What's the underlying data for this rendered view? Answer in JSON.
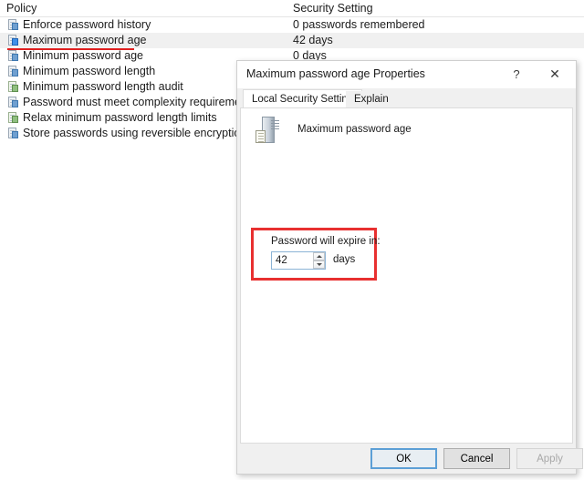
{
  "colors": {
    "annotation_red": "#e83030",
    "selection_gray": "#f0f0f0",
    "focus_blue": "#5c9fd6"
  },
  "policy_list": {
    "columns": [
      "Policy",
      "Security Setting"
    ],
    "rows": [
      {
        "icon": "policy-document-icon",
        "name": "Enforce password history",
        "setting": "0 passwords remembered",
        "selected": false
      },
      {
        "icon": "policy-document-icon",
        "name": "Maximum password age",
        "setting": "42 days",
        "selected": true
      },
      {
        "icon": "policy-document-icon",
        "name": "Minimum password age",
        "setting": "0 days",
        "selected": false
      },
      {
        "icon": "policy-document-icon",
        "name": "Minimum password length",
        "setting": "",
        "selected": false
      },
      {
        "icon": "policy-audit-icon",
        "name": "Minimum password length audit",
        "setting": "",
        "selected": false
      },
      {
        "icon": "policy-document-icon",
        "name": "Password must meet complexity requirements",
        "setting": "",
        "selected": false
      },
      {
        "icon": "policy-audit-icon",
        "name": "Relax minimum password length limits",
        "setting": "",
        "selected": false
      },
      {
        "icon": "policy-document-icon",
        "name": "Store passwords using reversible encryption",
        "setting": "",
        "selected": false
      }
    ]
  },
  "dialog": {
    "title": "Maximum password age Properties",
    "help_label": "?",
    "close_label": "✕",
    "tabs": [
      {
        "label": "Local Security Setting",
        "active": true
      },
      {
        "label": "Explain",
        "active": false
      }
    ],
    "policy_heading": "Maximum password age",
    "setting": {
      "label": "Password will expire in:",
      "value": "42",
      "placeholder": "0",
      "unit": "days",
      "spin_up": "▲",
      "spin_down": "▼"
    },
    "buttons": {
      "ok": "OK",
      "cancel": "Cancel",
      "apply": "Apply"
    }
  }
}
